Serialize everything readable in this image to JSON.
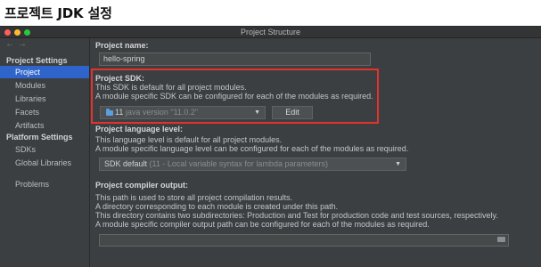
{
  "page_heading": "프로젝트 JDK 설정",
  "window": {
    "title": "Project Structure"
  },
  "nav": {
    "back": "←",
    "forward": "→"
  },
  "sidebar": {
    "group1": "Project Settings",
    "items1": [
      "Project",
      "Modules",
      "Libraries",
      "Facets",
      "Artifacts"
    ],
    "group2": "Platform Settings",
    "items2": [
      "SDKs",
      "Global Libraries"
    ],
    "problems": "Problems",
    "selected": "Project"
  },
  "project_name": {
    "label": "Project name:",
    "value": "hello-spring"
  },
  "project_sdk": {
    "label": "Project SDK:",
    "line1": "This SDK is default for all project modules.",
    "line2": "A module specific SDK can be configured for each of the modules as required.",
    "sdk_name": "11",
    "sdk_detail": "java version \"11.0.2\"",
    "edit_label": "Edit",
    "highlight_color": "#e5322c"
  },
  "language_level": {
    "label": "Project language level:",
    "line1": "This language level is default for all project modules.",
    "line2": "A module specific language level can be configured for each of the modules as required.",
    "value": "SDK default",
    "detail": "(11 - Local variable syntax for lambda parameters)"
  },
  "compiler_output": {
    "label": "Project compiler output:",
    "lines": [
      "This path is used to store all project compilation results.",
      "A directory corresponding to each module is created under this path.",
      "This directory contains two subdirectories: Production and Test for production code and test sources, respectively.",
      "A module specific compiler output path can be configured for each of the modules as required."
    ],
    "value": ""
  }
}
